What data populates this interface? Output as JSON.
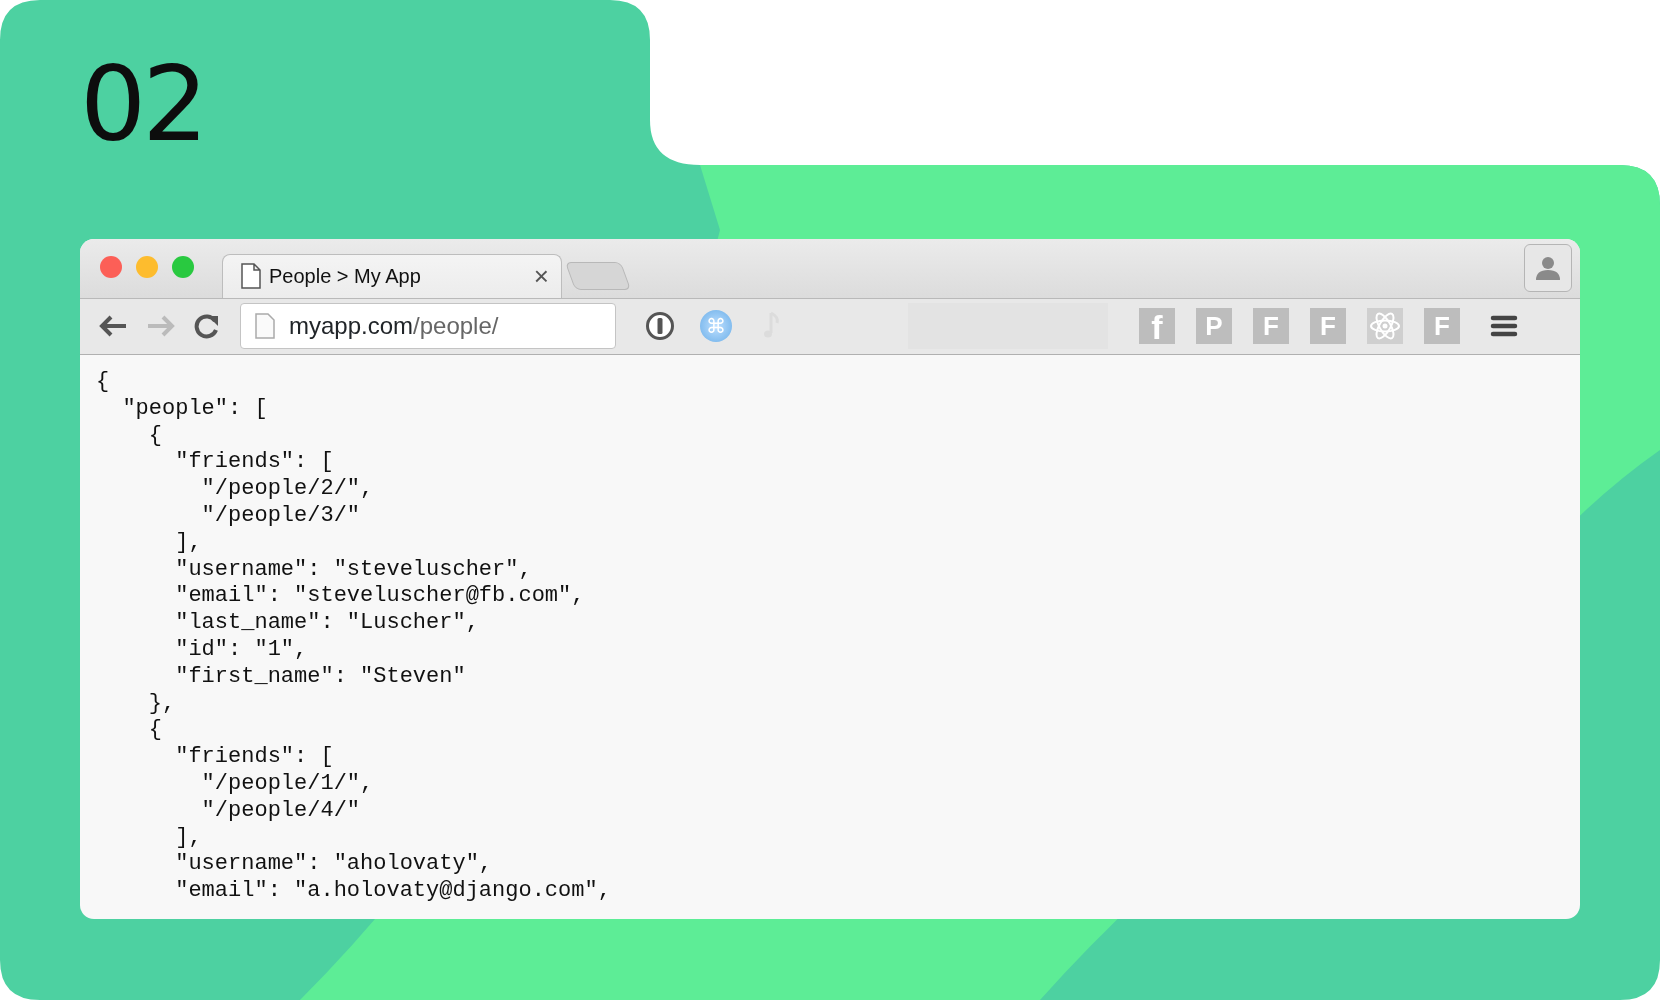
{
  "slide_number": "02",
  "browser": {
    "tab": {
      "title": "People > My App",
      "close": "×"
    },
    "address": {
      "host": "myapp.com",
      "path": "/people/"
    },
    "extensions": [
      {
        "kind": "password"
      },
      {
        "kind": "command",
        "text": "⌘"
      },
      {
        "kind": "note"
      },
      {
        "kind": "blank"
      }
    ],
    "bookmarks": [
      {
        "kind": "letter",
        "text": "f"
      },
      {
        "kind": "letter",
        "text": "P"
      },
      {
        "kind": "letter",
        "text": "F"
      },
      {
        "kind": "letter",
        "text": "F"
      },
      {
        "kind": "atom"
      },
      {
        "kind": "letter",
        "text": "F"
      }
    ]
  },
  "code_lines": [
    "{",
    "  \"people\": [",
    "    {",
    "      \"friends\": [",
    "        \"/people/2/\",",
    "        \"/people/3/\"",
    "      ],",
    "      \"username\": \"steveluscher\",",
    "      \"email\": \"steveluscher@fb.com\",",
    "      \"last_name\": \"Luscher\",",
    "      \"id\": \"1\",",
    "      \"first_name\": \"Steven\"",
    "    },",
    "    {",
    "      \"friends\": [",
    "        \"/people/1/\",",
    "        \"/people/4/\"",
    "      ],",
    "      \"username\": \"aholovaty\",",
    "      \"email\": \"a.holovaty@django.com\","
  ]
}
